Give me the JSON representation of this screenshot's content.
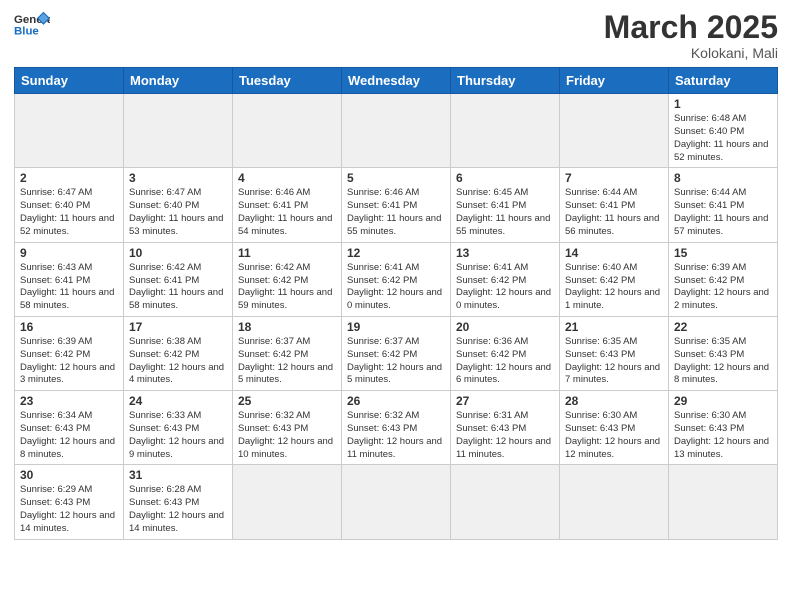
{
  "header": {
    "logo_general": "General",
    "logo_blue": "Blue",
    "month_title": "March 2025",
    "location": "Kolokani, Mali"
  },
  "weekdays": [
    "Sunday",
    "Monday",
    "Tuesday",
    "Wednesday",
    "Thursday",
    "Friday",
    "Saturday"
  ],
  "rows": [
    [
      {
        "day": "",
        "empty": true
      },
      {
        "day": "",
        "empty": true
      },
      {
        "day": "",
        "empty": true
      },
      {
        "day": "",
        "empty": true
      },
      {
        "day": "",
        "empty": true
      },
      {
        "day": "",
        "empty": true
      },
      {
        "day": "1",
        "sunrise": "6:48 AM",
        "sunset": "6:40 PM",
        "daylight": "11 hours and 52 minutes."
      }
    ],
    [
      {
        "day": "2",
        "sunrise": "6:47 AM",
        "sunset": "6:40 PM",
        "daylight": "11 hours and 52 minutes."
      },
      {
        "day": "3",
        "sunrise": "6:47 AM",
        "sunset": "6:40 PM",
        "daylight": "11 hours and 53 minutes."
      },
      {
        "day": "4",
        "sunrise": "6:46 AM",
        "sunset": "6:41 PM",
        "daylight": "11 hours and 54 minutes."
      },
      {
        "day": "5",
        "sunrise": "6:46 AM",
        "sunset": "6:41 PM",
        "daylight": "11 hours and 55 minutes."
      },
      {
        "day": "6",
        "sunrise": "6:45 AM",
        "sunset": "6:41 PM",
        "daylight": "11 hours and 55 minutes."
      },
      {
        "day": "7",
        "sunrise": "6:44 AM",
        "sunset": "6:41 PM",
        "daylight": "11 hours and 56 minutes."
      },
      {
        "day": "8",
        "sunrise": "6:44 AM",
        "sunset": "6:41 PM",
        "daylight": "11 hours and 57 minutes."
      }
    ],
    [
      {
        "day": "9",
        "sunrise": "6:43 AM",
        "sunset": "6:41 PM",
        "daylight": "11 hours and 58 minutes."
      },
      {
        "day": "10",
        "sunrise": "6:42 AM",
        "sunset": "6:41 PM",
        "daylight": "11 hours and 58 minutes."
      },
      {
        "day": "11",
        "sunrise": "6:42 AM",
        "sunset": "6:42 PM",
        "daylight": "11 hours and 59 minutes."
      },
      {
        "day": "12",
        "sunrise": "6:41 AM",
        "sunset": "6:42 PM",
        "daylight": "12 hours and 0 minutes."
      },
      {
        "day": "13",
        "sunrise": "6:41 AM",
        "sunset": "6:42 PM",
        "daylight": "12 hours and 0 minutes."
      },
      {
        "day": "14",
        "sunrise": "6:40 AM",
        "sunset": "6:42 PM",
        "daylight": "12 hours and 1 minute."
      },
      {
        "day": "15",
        "sunrise": "6:39 AM",
        "sunset": "6:42 PM",
        "daylight": "12 hours and 2 minutes."
      }
    ],
    [
      {
        "day": "16",
        "sunrise": "6:39 AM",
        "sunset": "6:42 PM",
        "daylight": "12 hours and 3 minutes."
      },
      {
        "day": "17",
        "sunrise": "6:38 AM",
        "sunset": "6:42 PM",
        "daylight": "12 hours and 4 minutes."
      },
      {
        "day": "18",
        "sunrise": "6:37 AM",
        "sunset": "6:42 PM",
        "daylight": "12 hours and 5 minutes."
      },
      {
        "day": "19",
        "sunrise": "6:37 AM",
        "sunset": "6:42 PM",
        "daylight": "12 hours and 5 minutes."
      },
      {
        "day": "20",
        "sunrise": "6:36 AM",
        "sunset": "6:42 PM",
        "daylight": "12 hours and 6 minutes."
      },
      {
        "day": "21",
        "sunrise": "6:35 AM",
        "sunset": "6:43 PM",
        "daylight": "12 hours and 7 minutes."
      },
      {
        "day": "22",
        "sunrise": "6:35 AM",
        "sunset": "6:43 PM",
        "daylight": "12 hours and 8 minutes."
      }
    ],
    [
      {
        "day": "23",
        "sunrise": "6:34 AM",
        "sunset": "6:43 PM",
        "daylight": "12 hours and 8 minutes."
      },
      {
        "day": "24",
        "sunrise": "6:33 AM",
        "sunset": "6:43 PM",
        "daylight": "12 hours and 9 minutes."
      },
      {
        "day": "25",
        "sunrise": "6:32 AM",
        "sunset": "6:43 PM",
        "daylight": "12 hours and 10 minutes."
      },
      {
        "day": "26",
        "sunrise": "6:32 AM",
        "sunset": "6:43 PM",
        "daylight": "12 hours and 11 minutes."
      },
      {
        "day": "27",
        "sunrise": "6:31 AM",
        "sunset": "6:43 PM",
        "daylight": "12 hours and 11 minutes."
      },
      {
        "day": "28",
        "sunrise": "6:30 AM",
        "sunset": "6:43 PM",
        "daylight": "12 hours and 12 minutes."
      },
      {
        "day": "29",
        "sunrise": "6:30 AM",
        "sunset": "6:43 PM",
        "daylight": "12 hours and 13 minutes."
      }
    ],
    [
      {
        "day": "30",
        "sunrise": "6:29 AM",
        "sunset": "6:43 PM",
        "daylight": "12 hours and 14 minutes."
      },
      {
        "day": "31",
        "sunrise": "6:28 AM",
        "sunset": "6:43 PM",
        "daylight": "12 hours and 14 minutes."
      },
      {
        "day": "",
        "empty": true
      },
      {
        "day": "",
        "empty": true
      },
      {
        "day": "",
        "empty": true
      },
      {
        "day": "",
        "empty": true
      },
      {
        "day": "",
        "empty": true
      }
    ]
  ]
}
